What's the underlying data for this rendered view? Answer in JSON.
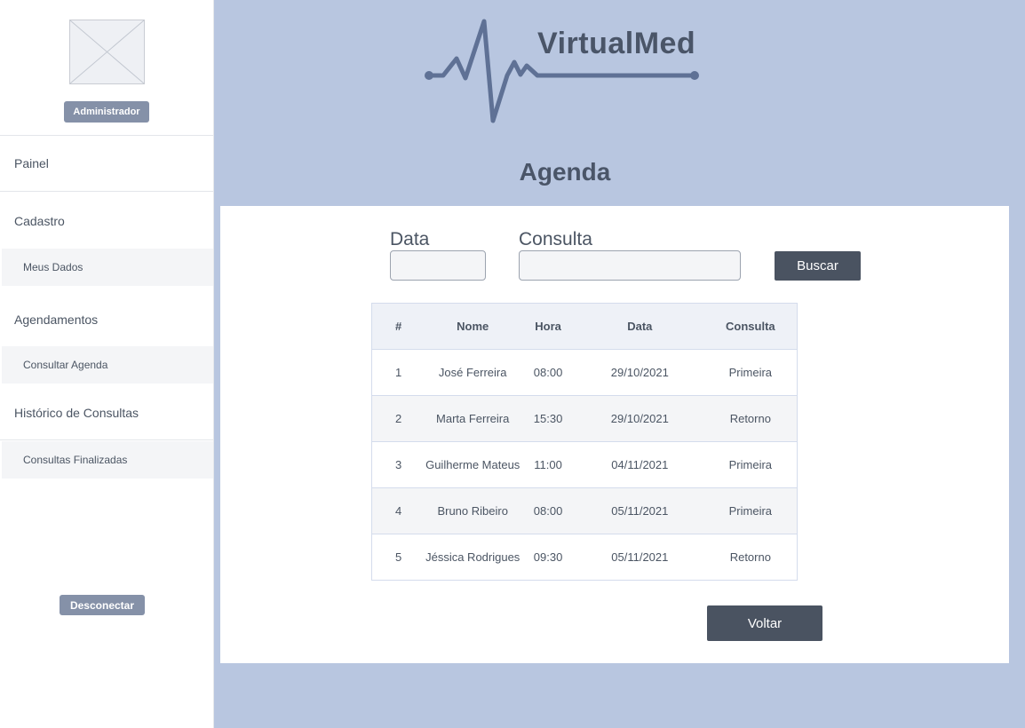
{
  "sidebar": {
    "avatar_icon": "image-placeholder-icon",
    "role": "Administrador",
    "nav_top": "Painel",
    "sections": [
      {
        "label": "Cadastro",
        "sub": "Meus Dados"
      },
      {
        "label": "Agendamentos",
        "sub": "Consultar Agenda"
      },
      {
        "label": "Histórico de Consultas",
        "sub": "Consultas Finalizadas"
      }
    ],
    "logout": "Desconectar"
  },
  "header": {
    "brand": "VirtualMed",
    "logo_icon": "heartbeat-line-icon",
    "title": "Agenda"
  },
  "search": {
    "date_label": "Data",
    "date_value": "",
    "consulta_label": "Consulta",
    "consulta_value": "",
    "button": "Buscar"
  },
  "table": {
    "headers": [
      "#",
      "Nome",
      "Hora",
      "Data",
      "Consulta"
    ],
    "rows": [
      [
        "1",
        "José Ferreira",
        "08:00",
        "29/10/2021",
        "Primeira"
      ],
      [
        "2",
        "Marta Ferreira",
        "15:30",
        "29/10/2021",
        "Retorno"
      ],
      [
        "3",
        "Guilherme Mateus",
        "11:00",
        "04/11/2021",
        "Primeira"
      ],
      [
        "4",
        "Bruno Ribeiro",
        "08:00",
        "05/11/2021",
        "Primeira"
      ],
      [
        "5",
        "Jéssica Rodrigues",
        "09:30",
        "05/11/2021",
        "Retorno"
      ]
    ]
  },
  "footer": {
    "back_button": "Voltar"
  },
  "colors": {
    "background": "#b8c6e0",
    "button_dark": "#4a5361",
    "badge": "#8591a8",
    "logo": "#5f7195"
  }
}
